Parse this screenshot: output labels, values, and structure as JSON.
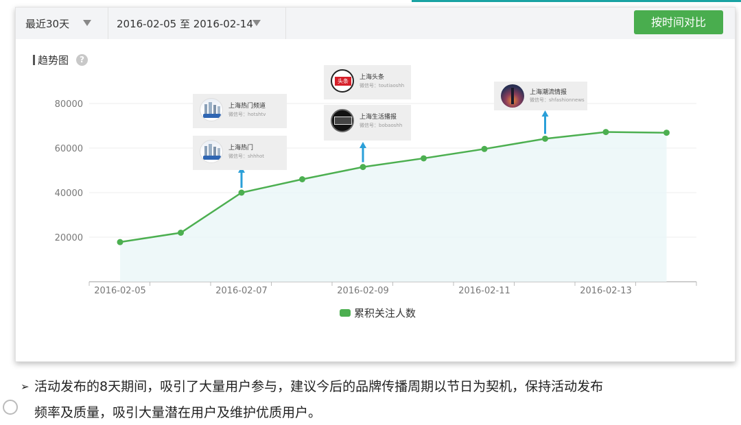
{
  "toolbar": {
    "period_label": "最近30天",
    "date_range": "2016-02-05 至 2016-02-14",
    "compare_button": "按时间对比"
  },
  "section_title": "趋势图",
  "help_icon": "question-circle-icon",
  "legend_label": "累积关注人数",
  "callouts": [
    {
      "id": "hotshtv",
      "name": "上海热门频道",
      "wx": "微信号：hotshtv",
      "icon": "city-skyline-avatar"
    },
    {
      "id": "shhot",
      "name": "上海热门",
      "wx": "微信号：shhhot",
      "icon": "city-skyline-avatar"
    },
    {
      "id": "toutiao",
      "name": "上海头条",
      "wx": "微信号：toutiaoshh",
      "icon": "toutiao-logo-avatar",
      "badge": "头条"
    },
    {
      "id": "bobaoshh",
      "name": "上海生活播报",
      "wx": "微信号：bobaoshh",
      "icon": "life-news-avatar"
    },
    {
      "id": "fashion",
      "name": "上海潮流情报",
      "wx": "微信号：shfashionnews",
      "icon": "fashion-city-avatar"
    }
  ],
  "note": {
    "line1": "活动发布的8天期间，吸引了大量用户参与，建议今后的品牌传播周期以节日为契机，保持活动发布",
    "line2": "频率及质量，吸引大量潜在用户及维护优质用户。"
  },
  "colors": {
    "accent_green": "#49ad4e",
    "line_green": "#4caf50",
    "arrow_blue": "#2a9fd8",
    "area_fill": "#eaf6f8"
  },
  "chart_data": {
    "type": "area",
    "title": "趋势图",
    "x": [
      "2016-02-05",
      "2016-02-06",
      "2016-02-07",
      "2016-02-08",
      "2016-02-09",
      "2016-02-10",
      "2016-02-11",
      "2016-02-12",
      "2016-02-13",
      "2016-02-14"
    ],
    "x_tick_labels": [
      "2016-02-05",
      "2016-02-07",
      "2016-02-09",
      "2016-02-11",
      "2016-02-13"
    ],
    "series": [
      {
        "name": "累积关注人数",
        "values": [
          17800,
          22000,
          40000,
          46000,
          51500,
          55400,
          59600,
          64200,
          67200,
          66900
        ]
      }
    ],
    "y_ticks": [
      20000,
      40000,
      60000,
      80000
    ],
    "ylim": [
      0,
      80000
    ],
    "grid": true,
    "legend_position": "bottom-center",
    "annotations": [
      {
        "x": "2016-02-07",
        "labels": [
          "上海热门频道",
          "上海热门"
        ]
      },
      {
        "x": "2016-02-09",
        "labels": [
          "上海头条",
          "上海生活播报"
        ]
      },
      {
        "x": "2016-02-12",
        "labels": [
          "上海潮流情报"
        ]
      }
    ]
  }
}
